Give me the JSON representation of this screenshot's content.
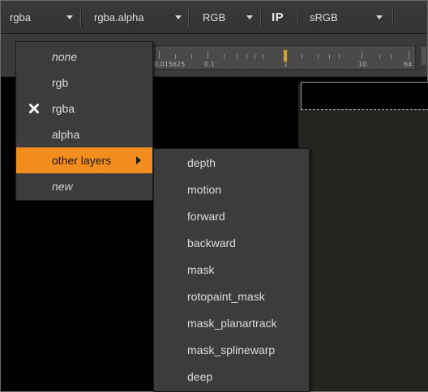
{
  "toolbar": {
    "channels_value": "rgba",
    "mask_value": "rgba.alpha",
    "display_value": "RGB",
    "ip_label": "IP",
    "lut_value": "sRGB"
  },
  "ruler": {
    "ticks": [
      "0.015625",
      "0.1",
      "1",
      "10",
      "64"
    ]
  },
  "layer_menu": {
    "items": [
      {
        "label": "none",
        "style": "italic"
      },
      {
        "label": "rgb"
      },
      {
        "label": "rgba",
        "checked": true
      },
      {
        "label": "alpha"
      },
      {
        "label": "other layers",
        "highlighted": true,
        "submenu": true
      },
      {
        "label": "new",
        "style": "italic"
      }
    ]
  },
  "submenu": {
    "items": [
      "depth",
      "motion",
      "forward",
      "backward",
      "mask",
      "rotopaint_mask",
      "mask_planartrack",
      "mask_splinewarp",
      "deep"
    ]
  },
  "colors": {
    "highlight": "#f28d1e",
    "menu_bg": "#3c3c3c",
    "toolbar_bg": "#363636",
    "slider_handle": "#c9a347"
  }
}
